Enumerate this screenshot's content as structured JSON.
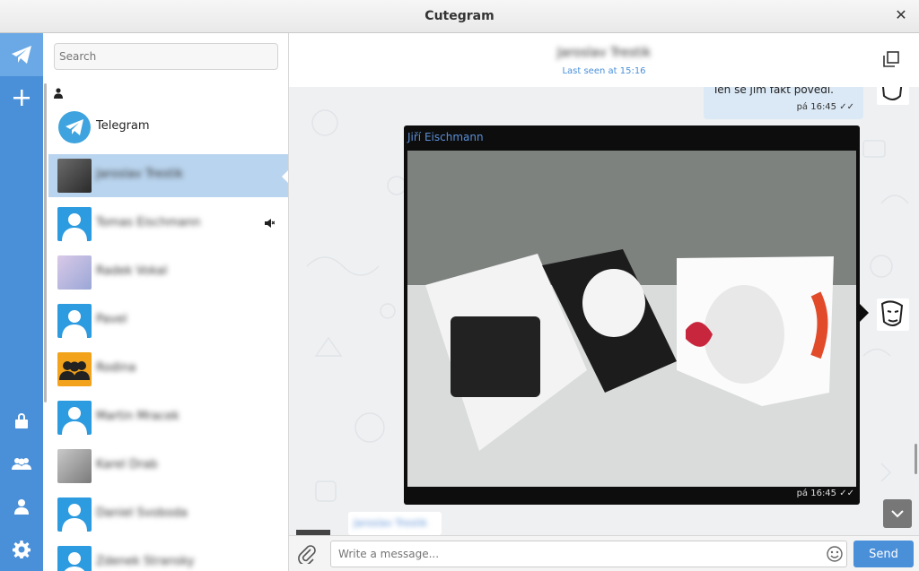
{
  "window": {
    "title": "Cutegram",
    "close_glyph": "✕"
  },
  "rail": {
    "items": [
      {
        "name": "telegram-logo-icon"
      },
      {
        "name": "new-chat-icon"
      },
      {
        "name": "lock-icon"
      },
      {
        "name": "contacts-group-icon"
      },
      {
        "name": "profile-icon"
      },
      {
        "name": "settings-gear-icon"
      }
    ]
  },
  "dialog_list": {
    "search_placeholder": "Search",
    "items": [
      {
        "name": "Telegram",
        "blurred": false,
        "active": false,
        "avatar": "telegram-logo"
      },
      {
        "name": "Jaroslav Trestik",
        "blurred": true,
        "active": true,
        "avatar": "photo"
      },
      {
        "name": "Tomas Eischmann",
        "blurred": true,
        "active": false,
        "avatar": "user",
        "muted": true
      },
      {
        "name": "Radek Vokal",
        "blurred": true,
        "active": false,
        "avatar": "photo"
      },
      {
        "name": "Pavel",
        "blurred": true,
        "active": false,
        "avatar": "user"
      },
      {
        "name": "Rodina",
        "blurred": true,
        "active": false,
        "avatar": "group"
      },
      {
        "name": "Martin Mracek",
        "blurred": true,
        "active": false,
        "avatar": "user"
      },
      {
        "name": "Karel Drab",
        "blurred": true,
        "active": false,
        "avatar": "photo"
      },
      {
        "name": "Daniel Svoboda",
        "blurred": true,
        "active": false,
        "avatar": "user"
      },
      {
        "name": "Zdenek Stransky",
        "blurred": true,
        "active": false,
        "avatar": "user"
      }
    ]
  },
  "chat": {
    "peer_name": "Jaroslav Trestik",
    "last_seen": "Last seen at 15:16",
    "messages": [
      {
        "text": "Ten se jim fakt povedl.",
        "time": "pá 16:45",
        "ticks": "✓✓"
      },
      {
        "sender": "Jiří Eischmann",
        "type": "photo",
        "time": "pá 16:45",
        "ticks": "✓✓"
      },
      {
        "text": "Jaroslav Trestik",
        "blurred": true
      }
    ],
    "composer": {
      "placeholder": "Write a message...",
      "send_label": "Send"
    }
  }
}
